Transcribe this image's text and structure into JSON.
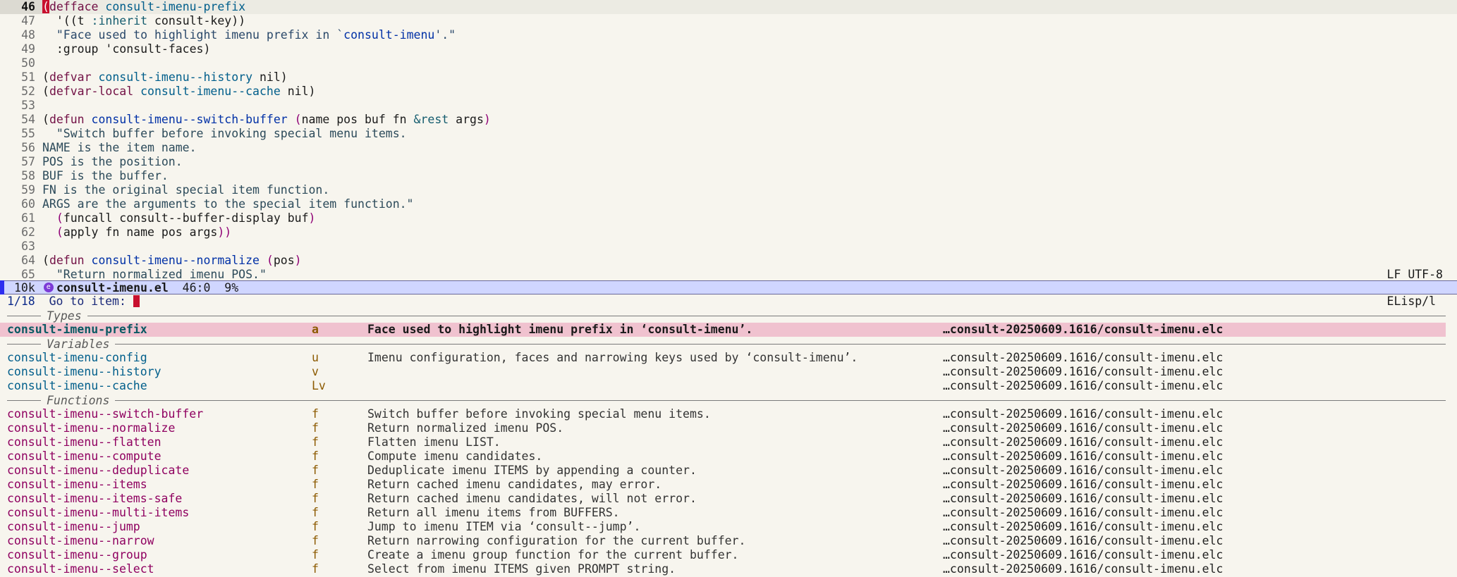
{
  "editor": {
    "lines": [
      {
        "n": "46",
        "current": true
      },
      {
        "n": "47"
      },
      {
        "n": "48"
      },
      {
        "n": "49"
      },
      {
        "n": "50"
      },
      {
        "n": "51"
      },
      {
        "n": "52"
      },
      {
        "n": "53"
      },
      {
        "n": "54"
      },
      {
        "n": "55"
      },
      {
        "n": "56"
      },
      {
        "n": "57"
      },
      {
        "n": "58"
      },
      {
        "n": "59"
      },
      {
        "n": "60"
      },
      {
        "n": "61"
      },
      {
        "n": "62"
      },
      {
        "n": "63"
      },
      {
        "n": "64"
      },
      {
        "n": "65"
      }
    ],
    "code": {
      "l46_kw": "defface",
      "l46_name": "consult-imenu-prefix",
      "l47_a": "'((t ",
      "l47_b": ":inherit",
      "l47_c": " consult-key))",
      "l48": "\"Face used to highlight imenu prefix in `",
      "l48_ref": "consult-imenu",
      "l48_end": "'.\"",
      "l49": ":group 'consult-faces)",
      "l51_kw": "defvar",
      "l51_name": "consult-imenu--history",
      "l51_rest": " nil)",
      "l52_kw": "defvar-local",
      "l52_name": "consult-imenu--cache",
      "l52_rest": " nil)",
      "l54_kw": "defun",
      "l54_name": "consult-imenu--switch-buffer",
      "l54_args": "name pos buf fn ",
      "l54_rest": "&rest",
      "l54_args2": " args",
      "l55": "\"Switch buffer before invoking special menu items.",
      "l56": "NAME is the item name.",
      "l57": "POS is the position.",
      "l58": "BUF is the buffer.",
      "l59": "FN is the original special item function.",
      "l60": "ARGS are the arguments to the special item function.\"",
      "l61": "funcall consult--buffer-display buf",
      "l62": "apply fn name pos args",
      "l64_kw": "defun",
      "l64_name": "consult-imenu--normalize",
      "l64_args": "pos",
      "l65": "\"Return normalized imenu POS.\""
    }
  },
  "modeline": {
    "size": "10k",
    "file": "consult-imenu.el",
    "position": "46:0",
    "percent": "9%",
    "encoding": "LF UTF-8",
    "mode": "ELisp/l"
  },
  "minibuffer": {
    "count": "1/18",
    "prompt": "Go to item: ",
    "groups": [
      {
        "title": "Types",
        "items": [
          {
            "name": "consult-imenu-prefix",
            "kind": "a",
            "doc": "Face used to highlight imenu prefix in ‘consult-imenu’.",
            "file": "…consult-20250609.1616/consult-imenu.elc",
            "selected": true
          }
        ]
      },
      {
        "title": "Variables",
        "items": [
          {
            "name": "consult-imenu-config",
            "kind": "u",
            "doc": "Imenu configuration, faces and narrowing keys used by ‘consult-imenu’.",
            "file": "…consult-20250609.1616/consult-imenu.elc"
          },
          {
            "name": "consult-imenu--history",
            "kind": "v",
            "doc": "",
            "file": "…consult-20250609.1616/consult-imenu.elc"
          },
          {
            "name": "consult-imenu--cache",
            "kind": "Lv",
            "doc": "",
            "file": "…consult-20250609.1616/consult-imenu.elc"
          }
        ]
      },
      {
        "title": "Functions",
        "items": [
          {
            "name": "consult-imenu--switch-buffer",
            "kind": "f",
            "doc": "Switch buffer before invoking special menu items.",
            "file": "…consult-20250609.1616/consult-imenu.elc"
          },
          {
            "name": "consult-imenu--normalize",
            "kind": "f",
            "doc": "Return normalized imenu POS.",
            "file": "…consult-20250609.1616/consult-imenu.elc"
          },
          {
            "name": "consult-imenu--flatten",
            "kind": "f",
            "doc": "Flatten imenu LIST.",
            "file": "…consult-20250609.1616/consult-imenu.elc"
          },
          {
            "name": "consult-imenu--compute",
            "kind": "f",
            "doc": "Compute imenu candidates.",
            "file": "…consult-20250609.1616/consult-imenu.elc"
          },
          {
            "name": "consult-imenu--deduplicate",
            "kind": "f",
            "doc": "Deduplicate imenu ITEMS by appending a counter.",
            "file": "…consult-20250609.1616/consult-imenu.elc"
          },
          {
            "name": "consult-imenu--items",
            "kind": "f",
            "doc": "Return cached imenu candidates, may error.",
            "file": "…consult-20250609.1616/consult-imenu.elc"
          },
          {
            "name": "consult-imenu--items-safe",
            "kind": "f",
            "doc": "Return cached imenu candidates, will not error.",
            "file": "…consult-20250609.1616/consult-imenu.elc"
          },
          {
            "name": "consult-imenu--multi-items",
            "kind": "f",
            "doc": "Return all imenu items from BUFFERS.",
            "file": "…consult-20250609.1616/consult-imenu.elc"
          },
          {
            "name": "consult-imenu--jump",
            "kind": "f",
            "doc": "Jump to imenu ITEM via ‘consult--jump’.",
            "file": "…consult-20250609.1616/consult-imenu.elc"
          },
          {
            "name": "consult-imenu--narrow",
            "kind": "f",
            "doc": "Return narrowing configuration for the current buffer.",
            "file": "…consult-20250609.1616/consult-imenu.elc"
          },
          {
            "name": "consult-imenu--group",
            "kind": "f",
            "doc": "Create a imenu group function for the current buffer.",
            "file": "…consult-20250609.1616/consult-imenu.elc"
          },
          {
            "name": "consult-imenu--select",
            "kind": "f",
            "doc": "Select from imenu ITEMS given PROMPT string.",
            "file": "…consult-20250609.1616/consult-imenu.elc"
          }
        ]
      }
    ]
  }
}
